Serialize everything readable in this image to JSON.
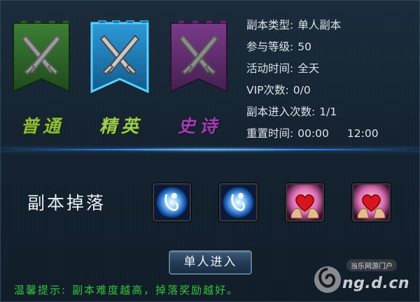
{
  "difficulties": [
    {
      "key": "normal",
      "label": "普通",
      "color": "#8fbf3a",
      "banner_color": "#2e6a2a",
      "selected": false
    },
    {
      "key": "elite",
      "label": "精英",
      "color": "#9fcd54",
      "banner_color": "#1d7fb8",
      "selected": true
    },
    {
      "key": "epic",
      "label": "史诗",
      "color": "#a13fb4",
      "banner_color": "#6a2a7a",
      "selected": false
    }
  ],
  "info": {
    "type_label": "副本类型:",
    "type_value": "单人副本",
    "level_label": "参与等级:",
    "level_value": "50",
    "time_label": "活动时间:",
    "time_value": "全天",
    "vip_label": "VIP次数:",
    "vip_value": "0/0",
    "entries_label": "副本进入次数:",
    "entries_value": "1/1",
    "reset_label": "重置时间:",
    "reset_value_1": "00:00",
    "reset_value_2": "12:00"
  },
  "drops": {
    "title": "副本掉落",
    "items": [
      {
        "icon": "blue-orb-icon"
      },
      {
        "icon": "blue-orb-icon"
      },
      {
        "icon": "heart-in-hands-icon"
      },
      {
        "icon": "heart-in-hands-icon"
      }
    ]
  },
  "enter_button": {
    "label": "单人进入"
  },
  "tip": {
    "prefix": "温馨提示:",
    "text": "副本难度越高，掉落奖励越好。"
  },
  "watermark": {
    "badge": "当乐网游门户",
    "site": "ng.d.cn"
  },
  "colors": {
    "tip_green": "#33c43a",
    "divider_blue": "#2f7fe0"
  }
}
